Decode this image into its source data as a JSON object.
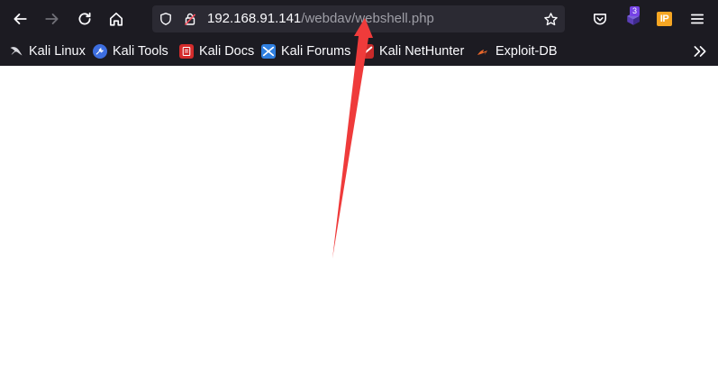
{
  "navbar": {
    "url_host": "192.168.91.141",
    "url_path": "/webdav/webshell.php",
    "extensions": {
      "badge_count": "3",
      "ip_label": "IP"
    }
  },
  "bookmarks": [
    {
      "label": "Kali Linux",
      "icon": "kali-dragon-icon"
    },
    {
      "label": "Kali Tools",
      "icon": "kali-tools-icon"
    },
    {
      "label": "Kali Docs",
      "icon": "kali-docs-icon"
    },
    {
      "label": "Kali Forums",
      "icon": "kali-forums-icon"
    },
    {
      "label": "Kali NetHunter",
      "icon": "kali-nethunter-icon"
    },
    {
      "label": "Exploit-DB",
      "icon": "exploit-db-icon"
    }
  ],
  "colors": {
    "toolbar_bg": "#1c1b22",
    "urlbar_bg": "#2b2a33",
    "text": "#fbfbfe",
    "url_path": "#9e9ea6",
    "annotation_arrow": "#ef3b3b"
  }
}
